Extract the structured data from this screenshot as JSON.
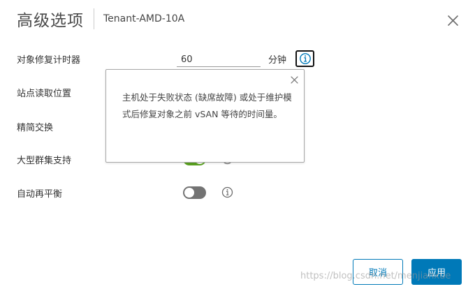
{
  "header": {
    "title": "高级选项",
    "subtitle": "Tenant-AMD-10A"
  },
  "settings": {
    "repair_timer": {
      "label": "对象修复计时器",
      "value": "60",
      "unit": "分钟"
    },
    "site_read_locality": {
      "label": "站点读取位置"
    },
    "thin_swap": {
      "label": "精简交换"
    },
    "large_cluster_support": {
      "label": "大型群集支持",
      "enabled": true
    },
    "auto_rebalance": {
      "label": "自动再平衡",
      "enabled": false
    }
  },
  "popover": {
    "text": "主机处于失败状态 (缺席故障) 或处于维护模式后修复对象之前 vSAN 等待的时间量。"
  },
  "footer": {
    "cancel_label": "取消",
    "apply_label": "应用"
  },
  "watermark": "https://blog.csdn.net/menjianxue",
  "colors": {
    "accent": "#0079b8",
    "toggle_on": "#5aa220",
    "toggle_off": "#737373"
  },
  "icons": [
    "close-icon",
    "info-icon"
  ]
}
